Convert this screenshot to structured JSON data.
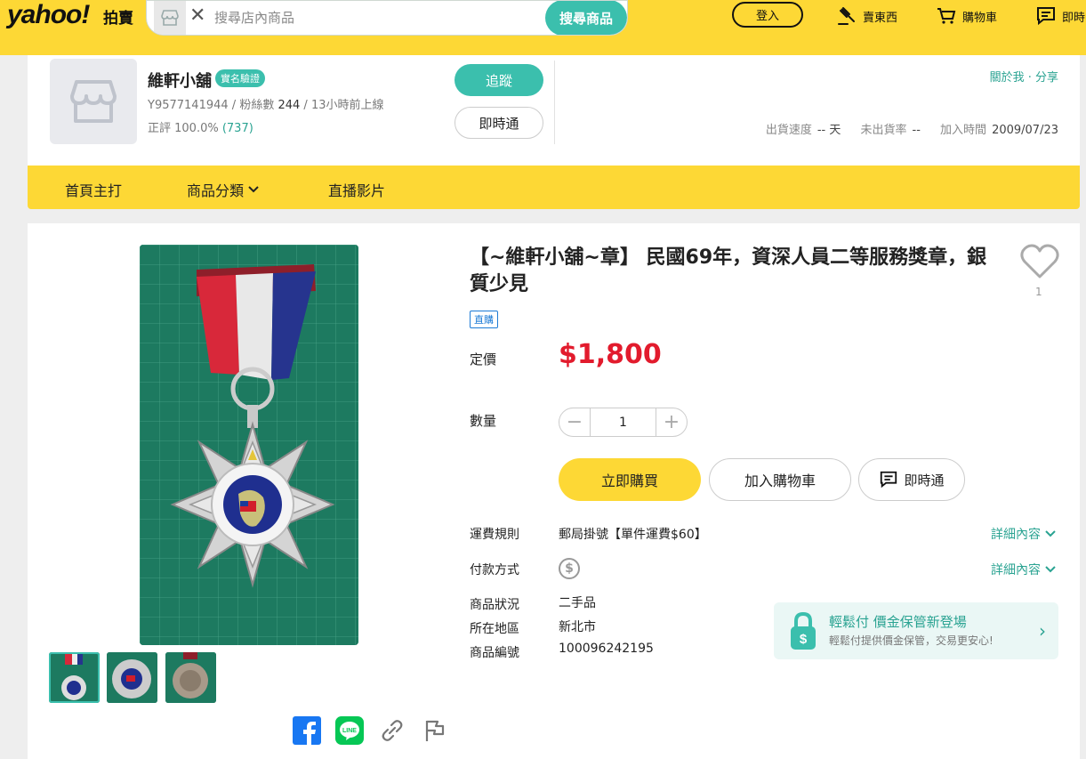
{
  "header": {
    "logo": "yahoo!",
    "logo_sub": "拍賣",
    "search_placeholder": "搜尋店內商品",
    "search_button": "搜尋商品",
    "login": "登入",
    "sell": "賣東西",
    "cart": "購物車",
    "chat": "即時"
  },
  "store": {
    "name": "維軒小舖",
    "verify_badge": "實名驗證",
    "seller_id": "Y9577141944",
    "fans_label": "粉絲數",
    "fans_count": "244",
    "last_online": "13小時前上線",
    "rating_label": "正評 100.0%",
    "rating_count": "(737)",
    "follow": "追蹤",
    "chat": "即時通",
    "about_links": "關於我 · 分享",
    "ship_speed_label": "出貨速度",
    "ship_speed_value": "-- 天",
    "no_ship_label": "未出貨率",
    "no_ship_value": "--",
    "join_label": "加入時間",
    "join_value": "2009/07/23"
  },
  "store_nav": {
    "home": "首頁主打",
    "categories": "商品分類",
    "live": "直播影片"
  },
  "product": {
    "title": "【~維軒小舖~章】 民國69年，資深人員二等服務獎章，銀質少見",
    "favorites": "1",
    "direct_badge": "直購",
    "price_label": "定價",
    "price": "$1,800",
    "qty_label": "數量",
    "qty_value": "1",
    "buy_now": "立即購買",
    "add_cart": "加入購物車",
    "chat": "即時通",
    "shipping_label": "運費規則",
    "shipping_value": "郵局掛號【單件運費$60】",
    "payment_label": "付款方式",
    "details": "詳細內容",
    "condition_label": "商品狀況",
    "condition_value": "二手品",
    "location_label": "所在地區",
    "location_value": "新北市",
    "item_no_label": "商品編號",
    "item_no_value": "100096242195"
  },
  "promo": {
    "title": "輕鬆付 價金保管新登場",
    "subtitle": "輕鬆付提供價金保管，交易更安心!"
  },
  "colors": {
    "brand_yellow": "#fdd835",
    "teal": "#3bbfad",
    "price_red": "#e21b2d"
  }
}
